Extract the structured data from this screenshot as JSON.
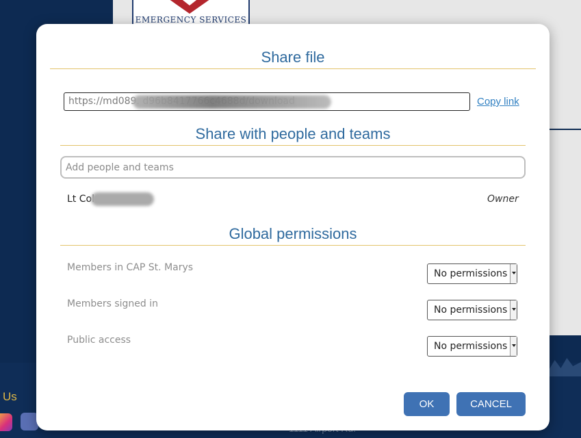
{
  "background": {
    "logo_text": "EMERGENCY SERVICES",
    "footer_contact": "Us",
    "footer_address": "1111 Airport Rd."
  },
  "dialog": {
    "title": "Share file",
    "share_link": {
      "url": "https://md089.                                          d96b8417766c4688d/download",
      "copy_label": "Copy link"
    },
    "people_section": {
      "title": "Share with people and teams",
      "input_placeholder": "Add people and teams",
      "entries": [
        {
          "name": "Lt Col",
          "role": "Owner"
        }
      ]
    },
    "global_section": {
      "title": "Global permissions",
      "rows": [
        {
          "label": "Members in CAP St. Marys",
          "value": "No permissions"
        },
        {
          "label": "Members signed in",
          "value": "No permissions"
        },
        {
          "label": "Public access",
          "value": "No permissions"
        }
      ]
    },
    "buttons": {
      "ok": "OK",
      "cancel": "CANCEL"
    }
  },
  "colors": {
    "accent": "#2f6a9e",
    "button": "#3f72b4",
    "rule": "#e3c36a",
    "link": "#2f7fc1"
  }
}
